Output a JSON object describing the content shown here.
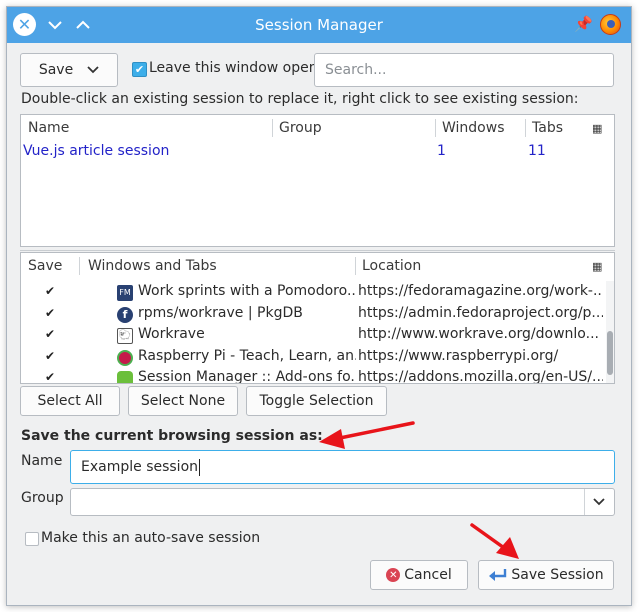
{
  "window": {
    "title": "Session Manager"
  },
  "toolbar": {
    "save_label": "Save",
    "leave_open_label": "Leave this window open",
    "leave_open_checked": true,
    "search_placeholder": "Search..."
  },
  "instruction": "Double-click an existing session to replace it, right click to see existing session:",
  "sessions_table": {
    "columns": [
      "Name",
      "Group",
      "Windows",
      "Tabs"
    ],
    "rows": [
      {
        "name": "Vue.js article session",
        "group": "",
        "windows": "1",
        "tabs": "11"
      }
    ]
  },
  "tabs_table": {
    "columns": [
      "Save",
      "Windows and Tabs",
      "Location"
    ],
    "rows": [
      {
        "checked": true,
        "favicon": "fedora-magazine-icon",
        "title": "Work sprints with a Pomodoro...",
        "location": "https://fedoramagazine.org/work-..."
      },
      {
        "checked": true,
        "favicon": "fedora-icon",
        "title": "rpms/workrave | PkgDB",
        "location": "https://admin.fedoraproject.org/p..."
      },
      {
        "checked": true,
        "favicon": "workrave-icon",
        "title": "Workrave",
        "location": "http://www.workrave.org/downlo..."
      },
      {
        "checked": true,
        "favicon": "raspberry-pi-icon",
        "title": "Raspberry Pi - Teach, Learn, an...",
        "location": "https://www.raspberrypi.org/"
      },
      {
        "checked": true,
        "favicon": "puzzle-addon-icon",
        "title": "Session Manager :: Add-ons fo...",
        "location": "https://addons.mozilla.org/en-US/..."
      }
    ]
  },
  "selection_buttons": {
    "select_all": "Select All",
    "select_none": "Select None",
    "toggle": "Toggle Selection"
  },
  "save_form": {
    "heading": "Save the current browsing session as:",
    "name_label": "Name",
    "name_value": "Example session",
    "group_label": "Group",
    "group_value": "",
    "autosave_label": "Make this an auto-save session",
    "autosave_checked": false
  },
  "footer": {
    "cancel_label": "Cancel",
    "save_session_label": "Save Session"
  },
  "colors": {
    "titlebar": "#4da3e6",
    "link_blue": "#2323c8",
    "annotation_red": "#e8141a",
    "accent": "#3daee9"
  }
}
